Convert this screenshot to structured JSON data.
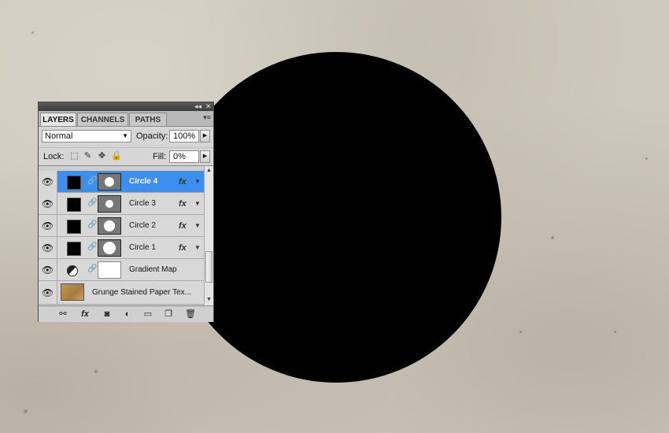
{
  "panel": {
    "tabs": [
      {
        "label": "LAYERS"
      },
      {
        "label": "CHANNELS"
      },
      {
        "label": "PATHS"
      }
    ],
    "titlebar": {
      "collapse_icon": "◂◂",
      "close_icon": "✕"
    },
    "menu_icon": "▾≡",
    "blend_mode": "Normal",
    "opacity_label": "Opacity:",
    "opacity_value": "100%",
    "lock_label": "Lock:",
    "fill_label": "Fill:",
    "fill_value": "0%",
    "layers": [
      {
        "name": "Circle 4",
        "selected": true,
        "fx": "fx"
      },
      {
        "name": "Circle 3",
        "selected": false,
        "fx": "fx"
      },
      {
        "name": "Circle 2",
        "selected": false,
        "fx": "fx"
      },
      {
        "name": "Circle 1",
        "selected": false,
        "fx": "fx"
      },
      {
        "name": "Gradient Map",
        "selected": false
      },
      {
        "name": "Grunge Stained Paper Tex..."
      }
    ],
    "bottom_icons": [
      "link-layers-icon",
      "fx-icon",
      "add-mask-icon",
      "adjustment-icon",
      "group-icon",
      "new-layer-icon",
      "trash-icon"
    ],
    "bottom_glyphs": {
      "link": "⚯",
      "fx": "fx",
      "mask": "◙",
      "adjust": "◐",
      "group": "▭",
      "new": "❐",
      "trash": "🗑"
    }
  },
  "colors": {
    "canvas_bg": "#cfc8bc",
    "circle": "#000000",
    "selection": "#3b8ff0"
  }
}
